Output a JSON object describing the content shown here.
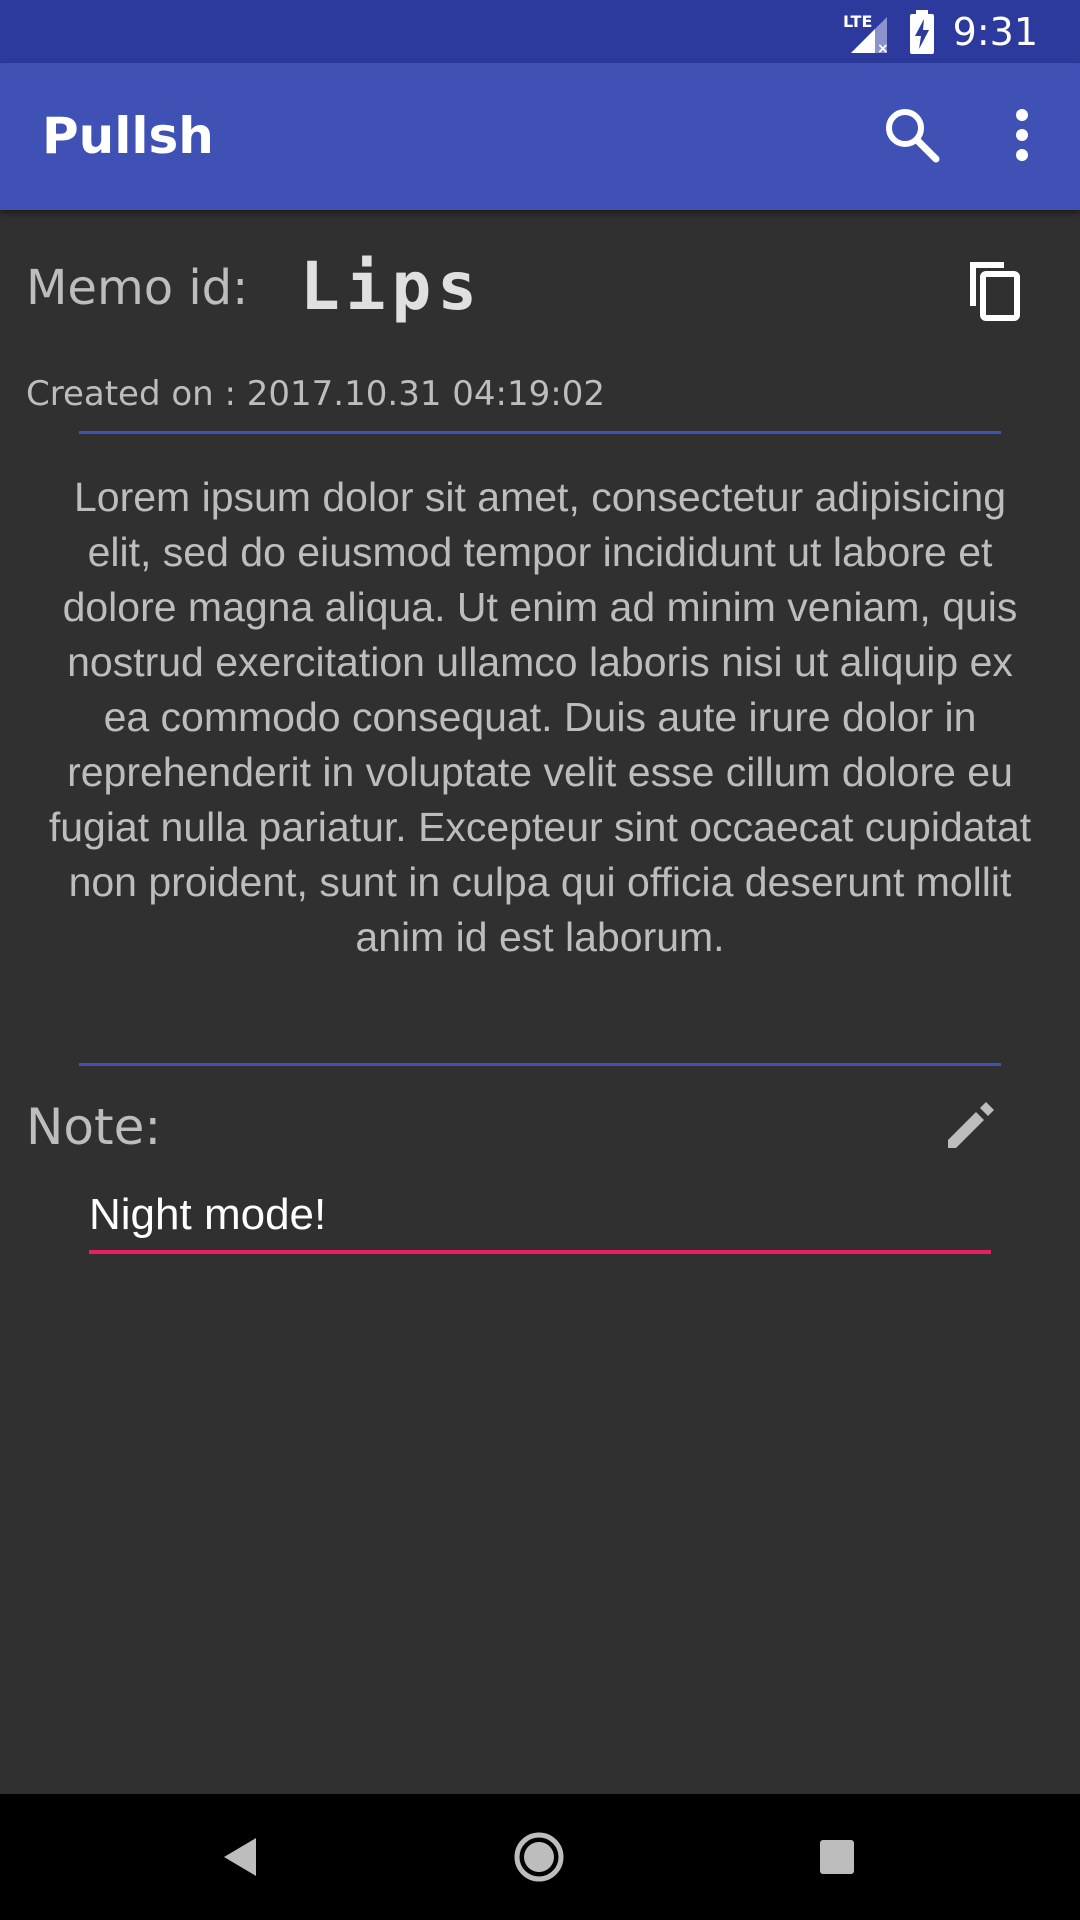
{
  "status_bar": {
    "time": "9:31",
    "network_label": "LTE",
    "icons": [
      "lte-signal-icon",
      "battery-charging-icon"
    ]
  },
  "app_bar": {
    "title": "Pullsh",
    "actions": [
      "search-icon",
      "more-vert-icon"
    ]
  },
  "memo": {
    "id_label": "Memo id:",
    "id_value": "Lips",
    "created": "Created on : 2017.10.31 04:19:02",
    "body": "Lorem ipsum dolor sit amet, consectetur adipisicing elit, sed do eiusmod tempor incididunt ut labore et dolore magna aliqua. Ut enim ad minim veniam, quis nostrud exercitation ullamco laboris nisi ut aliquip ex ea commodo consequat. Duis aute irure dolor in reprehenderit in voluptate velit esse cillum dolore eu fugiat nulla pariatur. Excepteur sint occaecat cupidatat non proident, sunt in culpa qui officia deserunt mollit anim id est laborum.",
    "copy_icon": "copy-icon"
  },
  "note": {
    "label": "Note:",
    "value": "Night mode!",
    "edit_icon": "edit-pencil-icon"
  },
  "nav_bar": {
    "buttons": [
      "back-icon",
      "home-icon",
      "recents-icon"
    ]
  },
  "colors": {
    "primary": "#3f51b5",
    "primary_dark": "#2c3a9e",
    "accent": "#e91e63",
    "background": "#303030",
    "text_secondary": "#bdbdbd"
  }
}
